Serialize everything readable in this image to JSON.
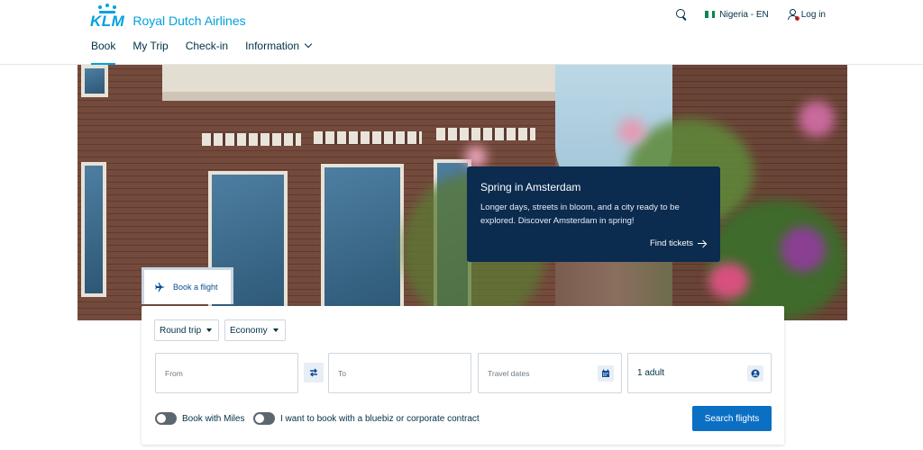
{
  "brand": {
    "logo_text": "KLM",
    "name": "Royal Dutch Airlines",
    "accent": "#00a1de"
  },
  "nav": {
    "items": [
      {
        "label": "Book",
        "active": true
      },
      {
        "label": "My Trip",
        "active": false
      },
      {
        "label": "Check-in",
        "active": false
      },
      {
        "label": "Information",
        "active": false,
        "icon": "chevron-down-icon"
      }
    ]
  },
  "header_right": {
    "search_icon": "search-icon",
    "language": "Nigeria - EN",
    "flag_colors": [
      "#008751",
      "#ffffff",
      "#008751"
    ],
    "login_label": "Log in",
    "login_icon": "user-icon"
  },
  "promo": {
    "title": "Spring in Amsterdam",
    "text": "Longer days, streets in bloom, and a city ready to be explored. Discover Amsterdam in spring!",
    "link_label": "Find tickets",
    "link_icon": "arrow-right-icon",
    "background": "#0b2b4f"
  },
  "booking": {
    "tab_label": "Book a flight",
    "tab_icon": "plane-icon",
    "trip_type": "Round trip",
    "cabin_class": "Economy",
    "from_placeholder": "From",
    "to_placeholder": "To",
    "dates_placeholder": "Travel dates",
    "passengers": "1 adult",
    "miles_label": "Book with Miles",
    "miles_on": false,
    "corporate_label": "I want to book with a bluebiz or corporate contract",
    "corporate_on": false,
    "search_button": "Search flights",
    "button_color": "#0b6fc4"
  }
}
